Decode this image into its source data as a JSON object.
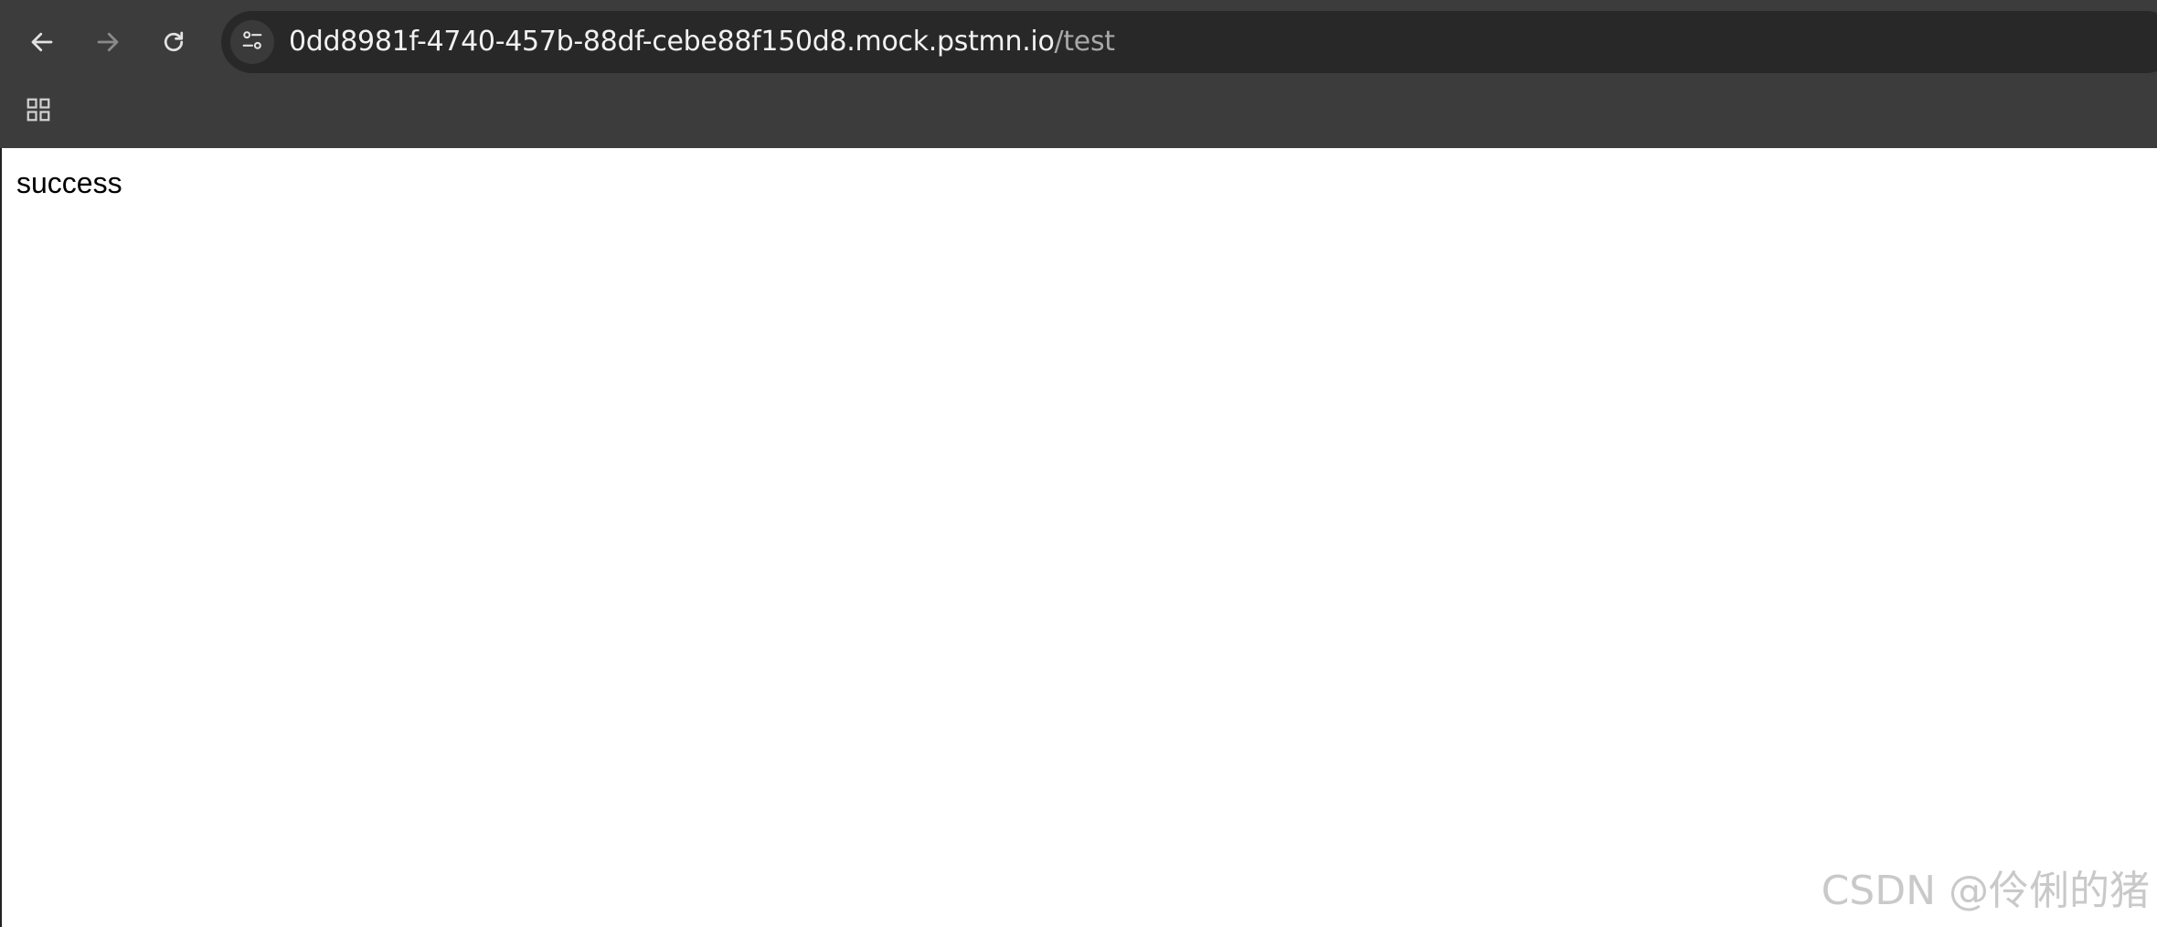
{
  "browser": {
    "url_host": "0dd8981f-4740-457b-88df-cebe88f150d8.mock.pstmn.io",
    "url_path": "/test",
    "icons": {
      "back": "back-arrow-icon",
      "forward": "forward-arrow-icon",
      "reload": "reload-icon",
      "site_info": "tune-icon",
      "apps": "apps-grid-icon"
    }
  },
  "page": {
    "body_text": "success"
  },
  "watermark": {
    "text": "CSDN @伶俐的猪"
  },
  "colors": {
    "toolbar": "#3c3c3c",
    "omnibox": "#282828",
    "content_bg": "#ffffff"
  }
}
